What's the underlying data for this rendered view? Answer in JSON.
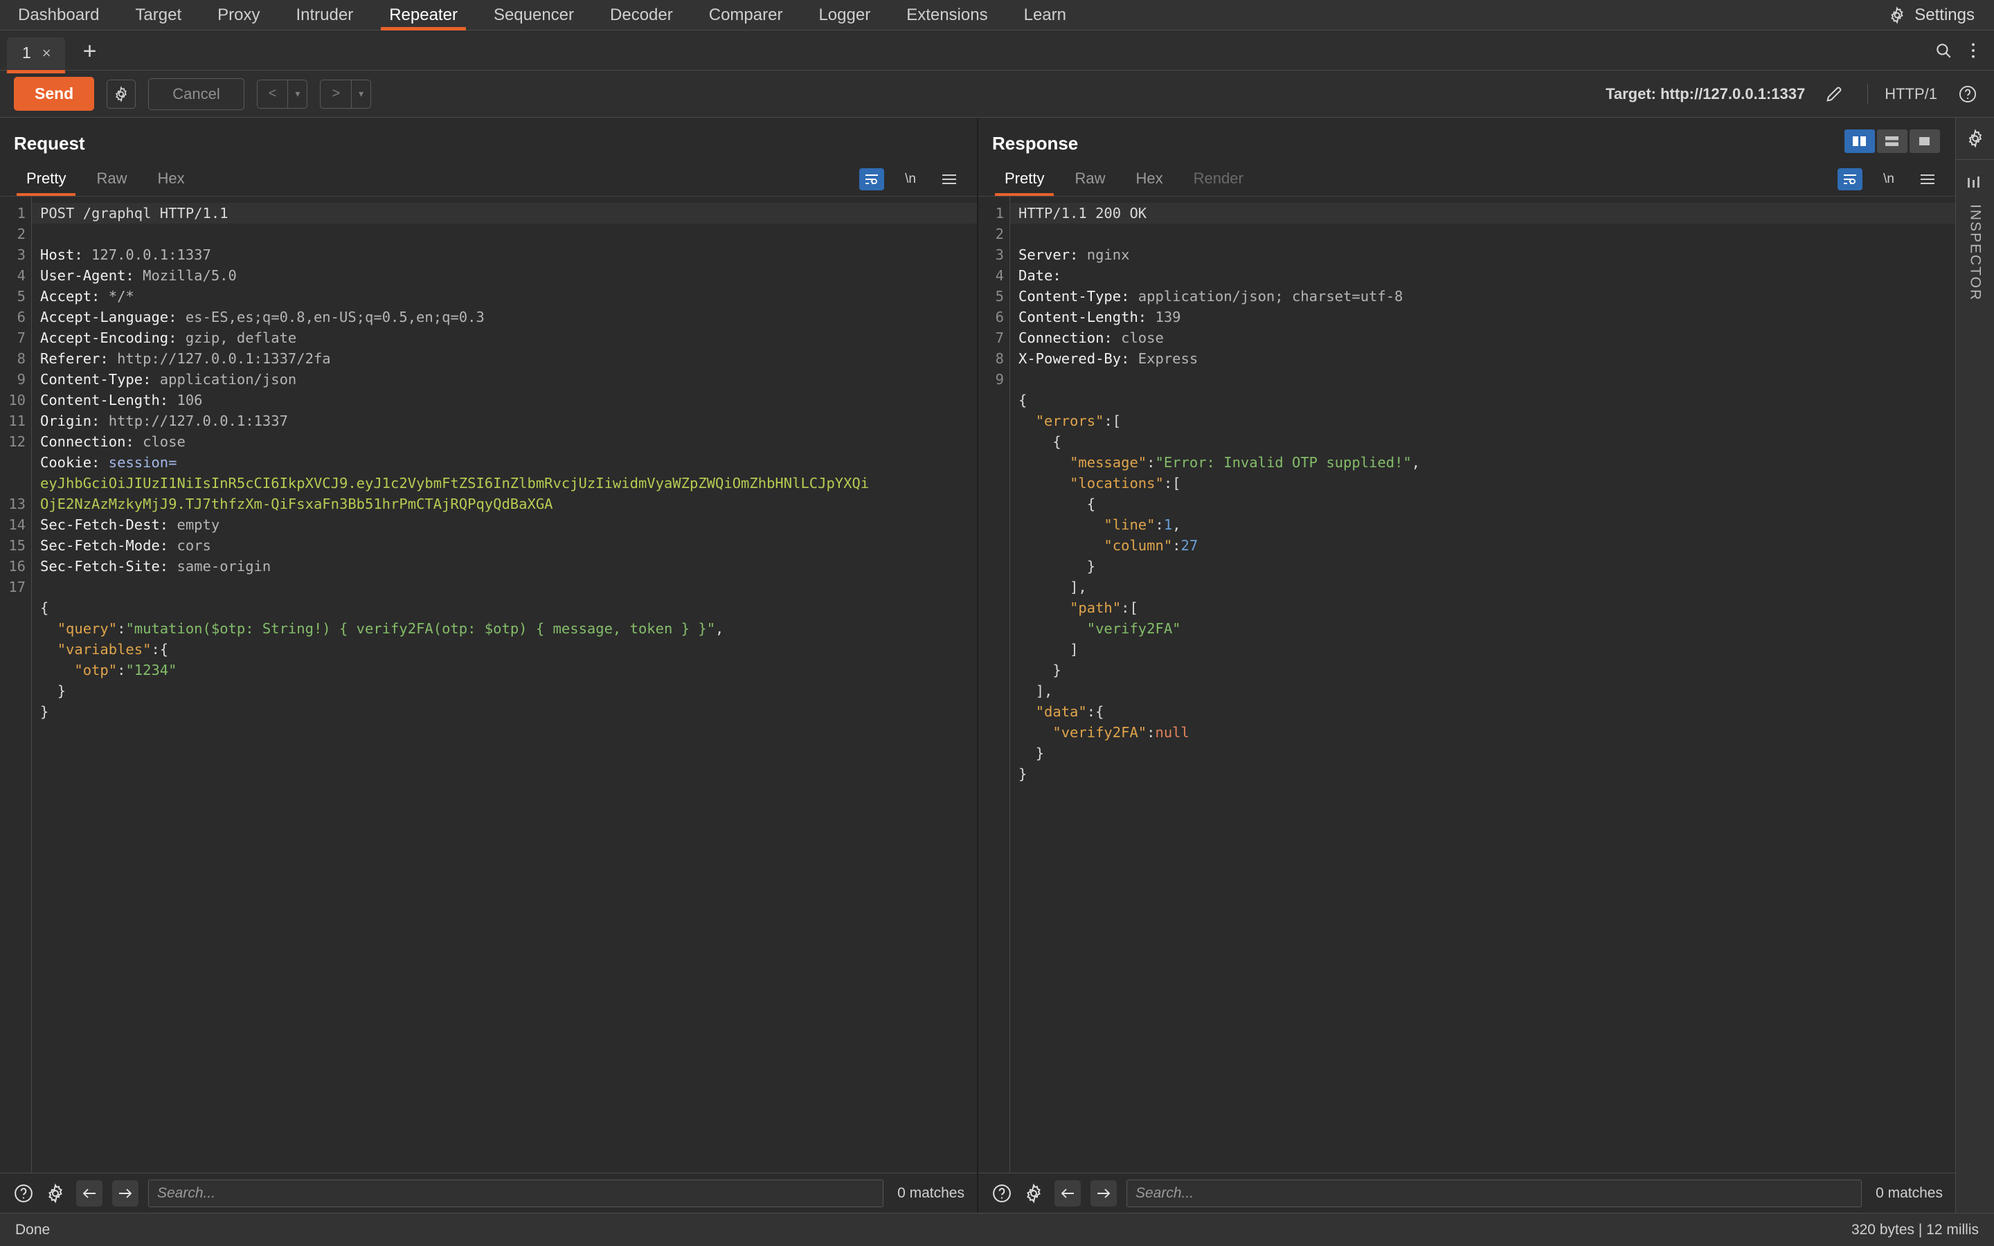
{
  "menubar": {
    "items": [
      {
        "label": "Dashboard",
        "active": false
      },
      {
        "label": "Target",
        "active": false
      },
      {
        "label": "Proxy",
        "active": false
      },
      {
        "label": "Intruder",
        "active": false
      },
      {
        "label": "Repeater",
        "active": true
      },
      {
        "label": "Sequencer",
        "active": false
      },
      {
        "label": "Decoder",
        "active": false
      },
      {
        "label": "Comparer",
        "active": false
      },
      {
        "label": "Logger",
        "active": false
      },
      {
        "label": "Extensions",
        "active": false
      },
      {
        "label": "Learn",
        "active": false
      }
    ],
    "settings_label": "Settings",
    "settings_icon": "gear-icon"
  },
  "tabstrip": {
    "tab_label": "1",
    "tab_close": "×",
    "add_label": "+",
    "search_icon": "search-icon",
    "menu_icon": "vertical-dots-icon"
  },
  "actionbar": {
    "send_label": "Send",
    "send_color": "#e8622c",
    "settings_icon": "gear-icon",
    "cancel_label": "Cancel",
    "prev_label": "<",
    "next_label": ">",
    "caret": "▾",
    "target_label": "Target: http://127.0.0.1:1337",
    "edit_icon": "pencil-icon",
    "http_version": "HTTP/1",
    "help_icon": "question-circle-icon"
  },
  "request": {
    "title": "Request",
    "tabs": [
      {
        "label": "Pretty",
        "active": true,
        "disabled": false
      },
      {
        "label": "Raw",
        "active": false,
        "disabled": false
      },
      {
        "label": "Hex",
        "active": false,
        "disabled": false
      }
    ],
    "toolbar": {
      "wrap_icon": "word-wrap-icon",
      "newline_label": "\\n",
      "menu_icon": "hamburger-icon"
    },
    "line_numbers": [
      "1",
      "2",
      "3",
      "4",
      "5",
      "6",
      "7",
      "8",
      "9",
      "10",
      "11",
      "12",
      "",
      "",
      "13",
      "14",
      "15",
      "16",
      "17",
      "",
      "",
      "",
      "",
      ""
    ],
    "lines": [
      {
        "type": "start",
        "text": "POST /graphql HTTP/1.1"
      },
      {
        "type": "header",
        "name": "Host:",
        "value": " 127.0.0.1:1337"
      },
      {
        "type": "header",
        "name": "User-Agent:",
        "value": " Mozilla/5.0"
      },
      {
        "type": "header",
        "name": "Accept:",
        "value": " */*"
      },
      {
        "type": "header",
        "name": "Accept-Language:",
        "value": " es-ES,es;q=0.8,en-US;q=0.5,en;q=0.3"
      },
      {
        "type": "header",
        "name": "Accept-Encoding:",
        "value": " gzip, deflate"
      },
      {
        "type": "header",
        "name": "Referer:",
        "value": " http://127.0.0.1:1337/2fa"
      },
      {
        "type": "header",
        "name": "Content-Type:",
        "value": " application/json"
      },
      {
        "type": "header",
        "name": "Content-Length:",
        "value": " 106"
      },
      {
        "type": "header",
        "name": "Origin:",
        "value": " http://127.0.0.1:1337"
      },
      {
        "type": "header",
        "name": "Connection:",
        "value": " close"
      },
      {
        "type": "cookie",
        "name": "Cookie:",
        "key": " session=",
        "value_line1": "eyJhbGciOiJIUzI1NiIsInR5cCI6IkpXVCJ9.eyJ1c2VybmFtZSI6InZlbmRvcjUzIiwidmVyaWZpZWQiOmZhbHNlLCJpYXQi",
        "value_line2": "OjE2NzAzMzkyMjJ9.TJ7thfzXm-QiFsxaFn3Bb51hrPmCTAjRQPqyQdBaXGA"
      },
      {
        "type": "header",
        "name": "Sec-Fetch-Dest:",
        "value": " empty"
      },
      {
        "type": "header",
        "name": "Sec-Fetch-Mode:",
        "value": " cors"
      },
      {
        "type": "header",
        "name": "Sec-Fetch-Site:",
        "value": " same-origin"
      },
      {
        "type": "blank",
        "text": ""
      }
    ],
    "body_lines": [
      {
        "indent": 0,
        "segments": [
          {
            "cls": "punct",
            "t": "{"
          }
        ]
      },
      {
        "indent": 1,
        "segments": [
          {
            "cls": "jkey",
            "t": "\"query\""
          },
          {
            "cls": "punct",
            "t": ":"
          },
          {
            "cls": "jstr",
            "t": "\"mutation($otp: String!) { verify2FA(otp: $otp) { message, token } }\""
          },
          {
            "cls": "punct",
            "t": ","
          }
        ]
      },
      {
        "indent": 1,
        "segments": [
          {
            "cls": "jkey",
            "t": "\"variables\""
          },
          {
            "cls": "punct",
            "t": ":{"
          }
        ]
      },
      {
        "indent": 2,
        "segments": [
          {
            "cls": "jkey",
            "t": "\"otp\""
          },
          {
            "cls": "punct",
            "t": ":"
          },
          {
            "cls": "jstr",
            "t": "\"1234\""
          }
        ]
      },
      {
        "indent": 1,
        "segments": [
          {
            "cls": "punct",
            "t": "}"
          }
        ]
      },
      {
        "indent": 0,
        "segments": [
          {
            "cls": "punct",
            "t": "}"
          }
        ]
      }
    ],
    "search": {
      "placeholder": "Search...",
      "value": "",
      "matches": "0 matches",
      "help_icon": "question-circle-icon",
      "settings_icon": "gear-icon",
      "prev_icon": "arrow-left-icon",
      "next_icon": "arrow-right-icon"
    }
  },
  "response": {
    "title": "Response",
    "tabs": [
      {
        "label": "Pretty",
        "active": true,
        "disabled": false
      },
      {
        "label": "Raw",
        "active": false,
        "disabled": false
      },
      {
        "label": "Hex",
        "active": false,
        "disabled": false
      },
      {
        "label": "Render",
        "active": false,
        "disabled": true
      }
    ],
    "layout_buttons": [
      {
        "name": "side-by-side-layout-icon",
        "active": true
      },
      {
        "name": "stacked-layout-icon",
        "active": false
      },
      {
        "name": "single-layout-icon",
        "active": false
      }
    ],
    "toolbar": {
      "wrap_icon": "word-wrap-icon",
      "newline_label": "\\n",
      "menu_icon": "hamburger-icon"
    },
    "line_numbers": [
      "1",
      "2",
      "3",
      "4",
      "5",
      "6",
      "7",
      "8",
      "9"
    ],
    "lines": [
      {
        "type": "start",
        "text": "HTTP/1.1 200 OK"
      },
      {
        "type": "header",
        "name": "Server:",
        "value": " nginx"
      },
      {
        "type": "header",
        "name": "Date:",
        "value": ""
      },
      {
        "type": "header",
        "name": "Content-Type:",
        "value": " application/json; charset=utf-8"
      },
      {
        "type": "header",
        "name": "Content-Length:",
        "value": " 139"
      },
      {
        "type": "header",
        "name": "Connection:",
        "value": " close"
      },
      {
        "type": "header",
        "name": "X-Powered-By:",
        "value": " Express"
      },
      {
        "type": "blank",
        "text": ""
      }
    ],
    "body_lines": [
      {
        "indent": 0,
        "segments": [
          {
            "cls": "punct",
            "t": "{"
          }
        ]
      },
      {
        "indent": 1,
        "segments": [
          {
            "cls": "jkey",
            "t": "\"errors\""
          },
          {
            "cls": "punct",
            "t": ":["
          }
        ]
      },
      {
        "indent": 2,
        "segments": [
          {
            "cls": "punct",
            "t": "{"
          }
        ]
      },
      {
        "indent": 3,
        "segments": [
          {
            "cls": "jkey",
            "t": "\"message\""
          },
          {
            "cls": "punct",
            "t": ":"
          },
          {
            "cls": "jstr",
            "t": "\"Error: Invalid OTP supplied!\""
          },
          {
            "cls": "punct",
            "t": ","
          }
        ]
      },
      {
        "indent": 3,
        "segments": [
          {
            "cls": "jkey",
            "t": "\"locations\""
          },
          {
            "cls": "punct",
            "t": ":["
          }
        ]
      },
      {
        "indent": 4,
        "segments": [
          {
            "cls": "punct",
            "t": "{"
          }
        ]
      },
      {
        "indent": 5,
        "segments": [
          {
            "cls": "jkey",
            "t": "\"line\""
          },
          {
            "cls": "punct",
            "t": ":"
          },
          {
            "cls": "jnum",
            "t": "1"
          },
          {
            "cls": "punct",
            "t": ","
          }
        ]
      },
      {
        "indent": 5,
        "segments": [
          {
            "cls": "jkey",
            "t": "\"column\""
          },
          {
            "cls": "punct",
            "t": ":"
          },
          {
            "cls": "jnum",
            "t": "27"
          }
        ]
      },
      {
        "indent": 4,
        "segments": [
          {
            "cls": "punct",
            "t": "}"
          }
        ]
      },
      {
        "indent": 3,
        "segments": [
          {
            "cls": "punct",
            "t": "],"
          }
        ]
      },
      {
        "indent": 3,
        "segments": [
          {
            "cls": "jkey",
            "t": "\"path\""
          },
          {
            "cls": "punct",
            "t": ":["
          }
        ]
      },
      {
        "indent": 4,
        "segments": [
          {
            "cls": "jstr",
            "t": "\"verify2FA\""
          }
        ]
      },
      {
        "indent": 3,
        "segments": [
          {
            "cls": "punct",
            "t": "]"
          }
        ]
      },
      {
        "indent": 2,
        "segments": [
          {
            "cls": "punct",
            "t": "}"
          }
        ]
      },
      {
        "indent": 1,
        "segments": [
          {
            "cls": "punct",
            "t": "],"
          }
        ]
      },
      {
        "indent": 1,
        "segments": [
          {
            "cls": "jkey",
            "t": "\"data\""
          },
          {
            "cls": "punct",
            "t": ":{"
          }
        ]
      },
      {
        "indent": 2,
        "segments": [
          {
            "cls": "jkey",
            "t": "\"verify2FA\""
          },
          {
            "cls": "punct",
            "t": ":"
          },
          {
            "cls": "jnull",
            "t": "null"
          }
        ]
      },
      {
        "indent": 1,
        "segments": [
          {
            "cls": "punct",
            "t": "}"
          }
        ]
      },
      {
        "indent": 0,
        "segments": [
          {
            "cls": "punct",
            "t": "}"
          }
        ]
      }
    ],
    "search": {
      "placeholder": "Search...",
      "value": "",
      "matches": "0 matches",
      "help_icon": "question-circle-icon",
      "settings_icon": "gear-icon",
      "prev_icon": "arrow-left-icon",
      "next_icon": "arrow-right-icon"
    }
  },
  "rail": {
    "settings_icon": "gear-icon",
    "columns_icon": "inspector-bars-icon",
    "label": "INSPECTOR"
  },
  "statusbar": {
    "status": "Done",
    "metrics": "320 bytes | 12 millis"
  },
  "colors": {
    "accent": "#e8622c",
    "selected_blue": "#2f6cb4",
    "background": "#2b2b2b",
    "chrome": "#333333",
    "json_key": "#e0a44b",
    "json_string": "#84bd6a",
    "json_number": "#6b9fd6",
    "json_null": "#e2825c",
    "cookie_value": "#b5cc52"
  }
}
